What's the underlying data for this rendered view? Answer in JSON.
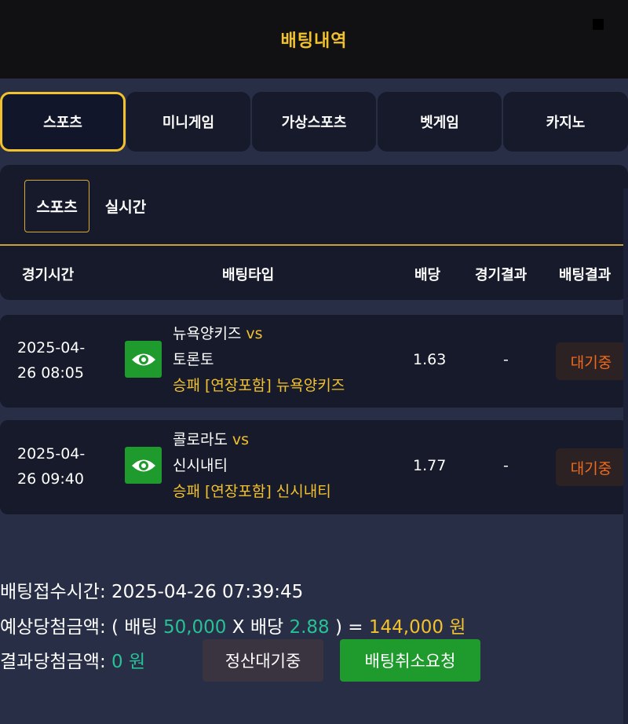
{
  "header": {
    "title": "배팅내역"
  },
  "main_tabs": [
    "스포츠",
    "미니게임",
    "가상스포츠",
    "벳게임",
    "카지노"
  ],
  "sub_tabs": [
    "스포츠",
    "실시간"
  ],
  "columns": {
    "time": "경기시간",
    "bet_type": "배팅타입",
    "odds": "배당",
    "game_result": "경기결과",
    "bet_result": "배팅결과"
  },
  "rows": [
    {
      "date": "2025-04-",
      "time": "26 08:05",
      "home": "뉴욕양키즈",
      "vs": "vs",
      "away": "토론토",
      "pick": "승패 [연장포함] 뉴욕양키즈",
      "odds": "1.63",
      "result": "-",
      "status": "대기중"
    },
    {
      "date": "2025-04-",
      "time": "26 09:40",
      "home": "콜로라도",
      "vs": "vs",
      "away": "신시내티",
      "pick": "승패 [연장포함] 신시내티",
      "odds": "1.77",
      "result": "-",
      "status": "대기중"
    }
  ],
  "summary": {
    "accept_label": "배팅접수시간:",
    "accept_time": "2025-04-26 07:39:45",
    "expected_label": "예상당첨금액:",
    "open_paren": "( 배팅",
    "bet_amount": "50,000",
    "x_odds": "X 배당",
    "total_odds": "2.88",
    "close_paren": ") =",
    "expected_amount": "144,000 원",
    "result_label": "결과당첨금액:",
    "result_amount": "0 원"
  },
  "buttons": {
    "settlement_wait": "정산대기중",
    "cancel_request": "배팅취소요청"
  },
  "icons": {
    "row_detail": "eye-icon"
  },
  "colors": {
    "accent": "#f2c12e",
    "green": "#1f9a2c",
    "teal_text": "#27c196",
    "status_orange": "#ee6a1c",
    "background": "#282e45",
    "panel": "#161a2b"
  }
}
